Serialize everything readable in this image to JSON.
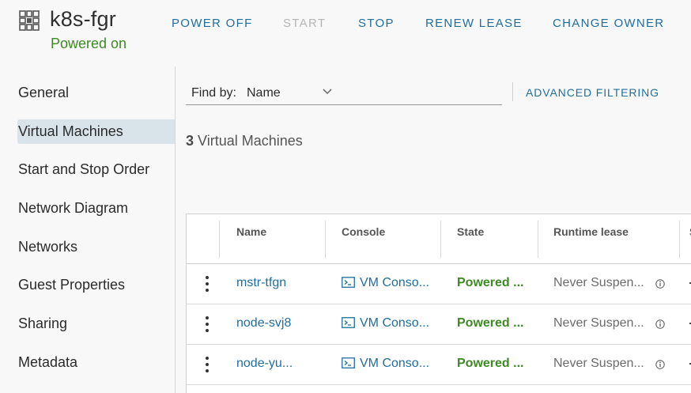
{
  "header": {
    "title": "k8s-fgr",
    "status": "Powered on",
    "app_icon": "vapp-grid-icon",
    "actions": [
      {
        "label": "POWER OFF",
        "enabled": true
      },
      {
        "label": "START",
        "enabled": false
      },
      {
        "label": "STOP",
        "enabled": true
      },
      {
        "label": "RENEW LEASE",
        "enabled": true
      },
      {
        "label": "CHANGE OWNER",
        "enabled": true
      }
    ]
  },
  "sidebar": {
    "items": [
      {
        "label": "General",
        "active": false
      },
      {
        "label": "Virtual Machines",
        "active": true
      },
      {
        "label": "Start and Stop Order",
        "active": false
      },
      {
        "label": "Network Diagram",
        "active": false
      },
      {
        "label": "Networks",
        "active": false
      },
      {
        "label": "Guest Properties",
        "active": false
      },
      {
        "label": "Sharing",
        "active": false
      },
      {
        "label": "Metadata",
        "active": false
      }
    ]
  },
  "toolbar": {
    "find_label": "Find by:",
    "find_value": "Name",
    "advanced_filtering": "ADVANCED FILTERING"
  },
  "summary": {
    "count": "3",
    "label": "Virtual Machines"
  },
  "grid": {
    "columns": [
      "Name",
      "Console",
      "State",
      "Runtime lease",
      "S"
    ],
    "rows": [
      {
        "name": "mstr-tfgn",
        "console": "VM Conso...",
        "state": "Powered ...",
        "lease": "Never Suspen..."
      },
      {
        "name": "node-svj8",
        "console": "VM Conso...",
        "state": "Powered ...",
        "lease": "Never Suspen..."
      },
      {
        "name": "node-yu...",
        "console": "VM Conso...",
        "state": "Powered ...",
        "lease": "Never Suspen..."
      }
    ]
  },
  "colors": {
    "link": "#1f6e9e",
    "success": "#3d8a23",
    "active_nav": "#d9e4ea",
    "disabled": "#b5b5b5"
  }
}
